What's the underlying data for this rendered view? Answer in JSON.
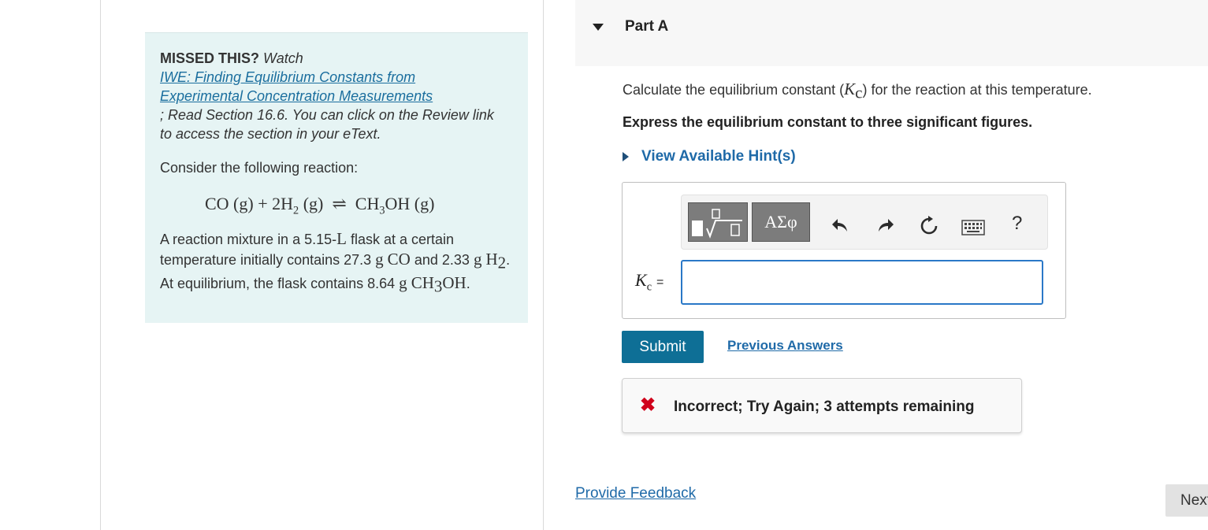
{
  "missed": {
    "heading": "MISSED THIS?",
    "watch": "Watch",
    "link_line1": "IWE: Finding Equilibrium Constants from",
    "link_line2": "Experimental Concentration Measurements",
    "read_text": "; Read Section 16.6. You can click on the Review link to access the section in your eText.",
    "consider": "Consider the following reaction:"
  },
  "reaction": {
    "reactant1": "CO (g)",
    "plus": "+",
    "coef": "2H",
    "h2_sub": "2",
    "h2_state": "(g)",
    "arrow": "⇌",
    "product": "CH",
    "ch3_sub": "3",
    "product_tail": "OH (g)"
  },
  "mixture": {
    "t1": "A reaction mixture in a 5.15-",
    "unit_L": "L",
    "t2": " flask at a certain temperature initially contains 27.3 ",
    "g1": "g",
    "co": "CO",
    "t3": " and 2.33 ",
    "g2": "g",
    "h2": "H",
    "h2_sub": "2",
    "t4": ". At equilibrium, the flask contains 8.64 ",
    "g3": "g",
    "ch3oh_a": "CH",
    "ch3oh_sub": "3",
    "ch3oh_b": "OH",
    "t5": "."
  },
  "part": {
    "title": "Part A",
    "calc_before": "Calculate the equilibrium constant (",
    "k": "K",
    "k_sub": "c",
    "calc_after": ") for the reaction at this temperature.",
    "express": "Express the equilibrium constant to three significant figures.",
    "hint_link": "View Available Hint(s)"
  },
  "toolbar": {
    "templates_icon": "sqrt-template-icon",
    "greek_label": "ΑΣφ",
    "undo": "undo-icon",
    "redo": "redo-icon",
    "reset": "reset-icon",
    "keyboard": "keyboard-icon",
    "help_label": "?"
  },
  "answer": {
    "k": "K",
    "k_sub": "c",
    "equals": "=",
    "value": ""
  },
  "actions": {
    "submit": "Submit",
    "previous_answers": "Previous Answers"
  },
  "feedback": {
    "status": "Incorrect; Try Again; 3 attempts remaining",
    "status_color": "#d0021b"
  },
  "footer": {
    "provide_feedback": "Provide Feedback",
    "next": "Next"
  }
}
